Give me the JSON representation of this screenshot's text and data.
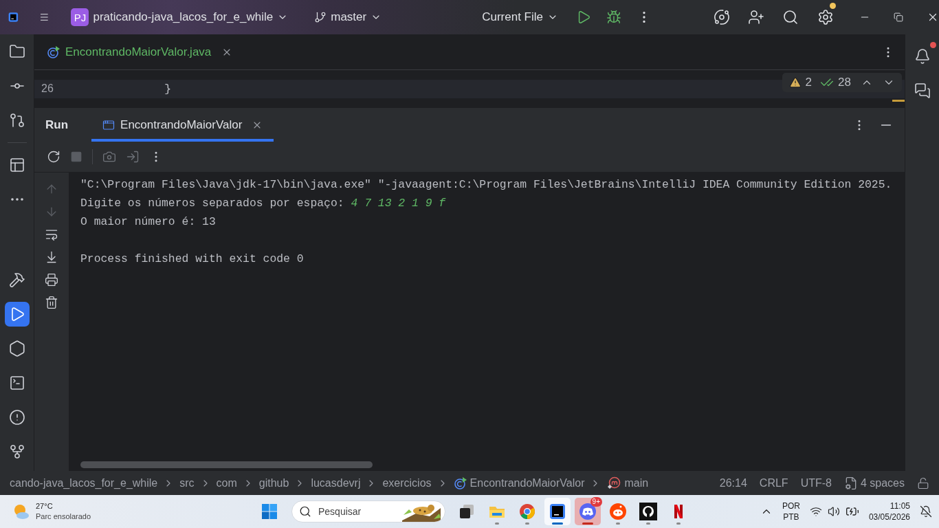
{
  "title_bar": {
    "project_badge": "PJ",
    "project": "praticando-java_lacos_for_e_while",
    "branch": "master",
    "run_config": "Current File",
    "settings_update": true
  },
  "editor": {
    "tabs": [
      {
        "label": "EncontrandoMaiorValor.java",
        "selected": true
      }
    ],
    "lines": [
      {
        "number": "26",
        "code": "}",
        "current": true
      }
    ],
    "inspections": {
      "warnings": "2",
      "weak_warnings": "28"
    }
  },
  "run_panel": {
    "title": "Run",
    "tabs": [
      {
        "label": "EncontrandoMaiorValor",
        "selected": true
      }
    ],
    "console": [
      {
        "text": "\"C:\\Program Files\\Java\\jdk-17\\bin\\java.exe\" \"-javaagent:C:\\Program Files\\JetBrains\\IntelliJ IDEA Community Edition 2025."
      },
      {
        "text": "Digite os números separados por espaço: ",
        "input": "4 7 13 2 1 9 f"
      },
      {
        "text": "O maior número é: 13"
      },
      {
        "text": "Process finished with exit code 0",
        "gap_before": true
      }
    ]
  },
  "notifications": {
    "unread": true
  },
  "status_bar": {
    "breadcrumbs": [
      {
        "label": "cando-java_lacos_for_e_while",
        "kind": "folder"
      },
      {
        "label": "src",
        "kind": "folder"
      },
      {
        "label": "com",
        "kind": "folder"
      },
      {
        "label": "github",
        "kind": "folder"
      },
      {
        "label": "lucasdevrj",
        "kind": "folder"
      },
      {
        "label": "exercicios",
        "kind": "folder"
      },
      {
        "label": "EncontrandoMaiorValor",
        "kind": "class"
      },
      {
        "label": "main",
        "kind": "method"
      }
    ],
    "position": "26:14",
    "line_separator": "CRLF",
    "encoding": "UTF-8",
    "indent": "4 spaces"
  },
  "taskbar": {
    "weather": {
      "temperature": "27°C",
      "condition": "Parc ensolarado"
    },
    "search": {
      "placeholder": "Pesquisar"
    },
    "apps": [
      {
        "kind": "task_view",
        "open": false,
        "selected": false,
        "flashing": false
      },
      {
        "kind": "files",
        "open": true,
        "selected": false,
        "flashing": false
      },
      {
        "kind": "chrome",
        "open": true,
        "selected": false,
        "flashing": false
      },
      {
        "kind": "intellij",
        "open": true,
        "selected": true,
        "flashing": false
      },
      {
        "kind": "discord",
        "open": true,
        "selected": false,
        "flashing": true,
        "badge": "9+"
      },
      {
        "kind": "reddit",
        "open": true,
        "selected": false,
        "flashing": false
      },
      {
        "kind": "github",
        "open": true,
        "selected": false,
        "flashing": false
      },
      {
        "kind": "netflix",
        "open": true,
        "selected": false,
        "flashing": false
      }
    ],
    "language": "POR",
    "layout": "PTB",
    "time": "11:05",
    "date": "03/05/2026"
  }
}
